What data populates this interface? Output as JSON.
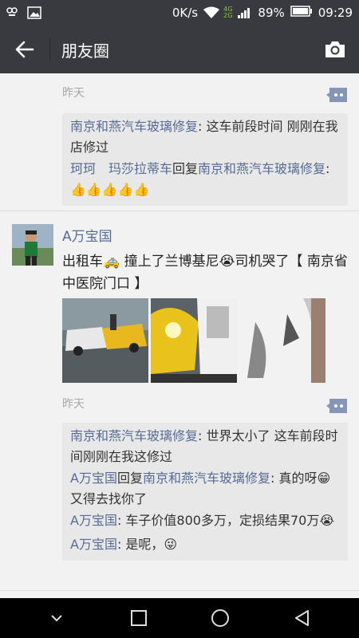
{
  "status": {
    "speed": "0K/s",
    "net4g": "4G",
    "net2g": "2G",
    "battery": "89%",
    "time": "09:29"
  },
  "header": {
    "title": "朋友圈"
  },
  "post1": {
    "time": "昨天",
    "c1_name": "南京和燕汽车玻璃修复",
    "c1_text": ": 这车前段时间 刚刚在我店修过",
    "c2_from": "珂珂　玛莎拉蒂车",
    "c2_reply": "回复",
    "c2_to": "南京和燕汽车玻璃修复",
    "c2_text": ": 👍👍👍👍👍"
  },
  "post2": {
    "user": "A万宝国",
    "text": "出租车🚕 撞上了兰博基尼😭司机哭了【 南京省中医院门口 】",
    "time": "昨天",
    "c1_name": "南京和燕汽车玻璃修复",
    "c1_text": ": 世界太小了  这车前段时间刚刚在我这修过",
    "c2_from": "A万宝国",
    "c2_reply": "回复",
    "c2_to": "南京和燕汽车玻璃修复",
    "c2_text": ": 真的呀😁又得去找你了",
    "c3_name": "A万宝国",
    "c3_text": ": 车子价值800多万，定损结果70万😭",
    "c4_name": "A万宝国",
    "c4_text": ": 是呢，😜"
  }
}
